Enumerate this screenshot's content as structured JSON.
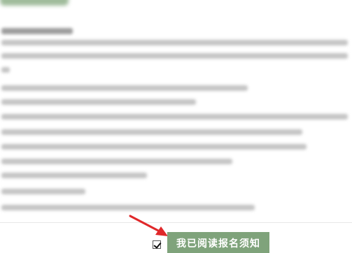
{
  "footer": {
    "agree_checked": true,
    "read_button_label": "我已阅读报名须知"
  },
  "colors": {
    "button_bg": "#7fa37b",
    "button_text": "#ffffff",
    "arrow": "#e0282a"
  },
  "icons": {
    "checkbox": "checkmark",
    "annotation": "red-arrow"
  }
}
